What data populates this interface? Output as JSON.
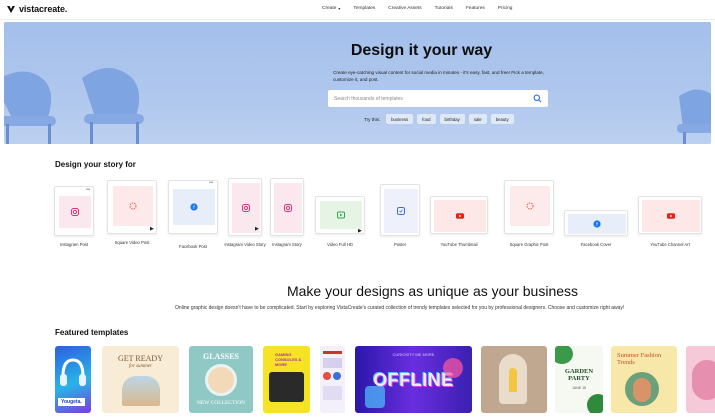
{
  "header": {
    "logo_text": "vistacreate.",
    "nav": [
      {
        "label": "Create",
        "has_caret": true
      },
      {
        "label": "Templates"
      },
      {
        "label": "Creative Assets"
      },
      {
        "label": "Tutorials"
      },
      {
        "label": "Features"
      },
      {
        "label": "Pricing"
      }
    ]
  },
  "hero": {
    "title": "Design it your way",
    "subtitle": "Create eye-catching visual content for social media in minutes - it's easy, fast, and free! Pick a template, customize it, and post.",
    "search_placeholder": "Search thousands of templates",
    "try_label": "Try this:",
    "chips": [
      "business",
      "food",
      "birthday",
      "sale",
      "beauty"
    ]
  },
  "story": {
    "title": "Design your story for",
    "formats": [
      {
        "label": "Instagram Post",
        "icon": "instagram-icon"
      },
      {
        "label": "Square Video Post",
        "icon": "video-spinner-icon"
      },
      {
        "label": "Facebook Post",
        "icon": "facebook-icon"
      },
      {
        "label": "Instagram Video Story",
        "icon": "instagram-icon"
      },
      {
        "label": "Instagram Story",
        "icon": "instagram-icon"
      },
      {
        "label": "Video Full HD",
        "icon": "play-icon"
      },
      {
        "label": "Poster",
        "icon": "poster-icon"
      },
      {
        "label": "YouTube Thumbnail",
        "icon": "youtube-icon"
      },
      {
        "label": "Square Graphic Post",
        "icon": "graphic-spinner-icon"
      },
      {
        "label": "Facebook Cover",
        "icon": "facebook-icon"
      },
      {
        "label": "YouTube Channel Art",
        "icon": "youtube-icon"
      }
    ]
  },
  "promo": {
    "heading": "Make your designs as unique as your business",
    "text": "Online graphic design doesn't have to be complicated. Start by exploring VistaCreate's curated collection of trendy templates selected for you by professional designers. Choose and customize right away!"
  },
  "featured": {
    "title": "Featured templates",
    "templates": [
      {
        "name": "template-yougeta",
        "text": "Yougeta."
      },
      {
        "name": "template-get-ready",
        "text": "GET READY",
        "text2": "for summer"
      },
      {
        "name": "template-glasses",
        "text": "GLASSES",
        "text2": "NEW COLLECTION"
      },
      {
        "name": "template-gaming",
        "text": "GAMING CONSOLES & MORE"
      },
      {
        "name": "template-infographic",
        "text": ""
      },
      {
        "name": "template-offline",
        "text": "OFFLINE",
        "text2": "CURIOSITY ME MORE"
      },
      {
        "name": "template-candle",
        "text": ""
      },
      {
        "name": "template-garden-party",
        "text": "GARDEN PARTY",
        "text2": "JUNE 15"
      },
      {
        "name": "template-summer-fashion",
        "text": "Summer Fashion Trends"
      },
      {
        "name": "template-pink",
        "text": ""
      }
    ]
  },
  "colors": {
    "hero_bg": "#a9c3ec",
    "search_icon": "#2f6fde",
    "youtube_red": "#e62117",
    "facebook_blue": "#1877f2",
    "instagram_pink": "#d6337a"
  }
}
